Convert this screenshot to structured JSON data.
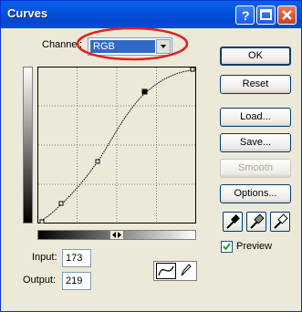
{
  "window": {
    "title": "Curves"
  },
  "channel": {
    "label": "Channel:",
    "value": "RGB"
  },
  "input": {
    "label": "Input:",
    "value": "173"
  },
  "output": {
    "label": "Output:",
    "value": "219"
  },
  "buttons": {
    "ok": "OK",
    "reset": "Reset",
    "load": "Load...",
    "save": "Save...",
    "smooth": "Smooth",
    "options": "Options..."
  },
  "preview": {
    "label": "Preview",
    "checked": true
  },
  "colors": {
    "titlebar": "#0454e0",
    "selection": "#316ac5",
    "highlight_ellipse": "#e02020"
  }
}
